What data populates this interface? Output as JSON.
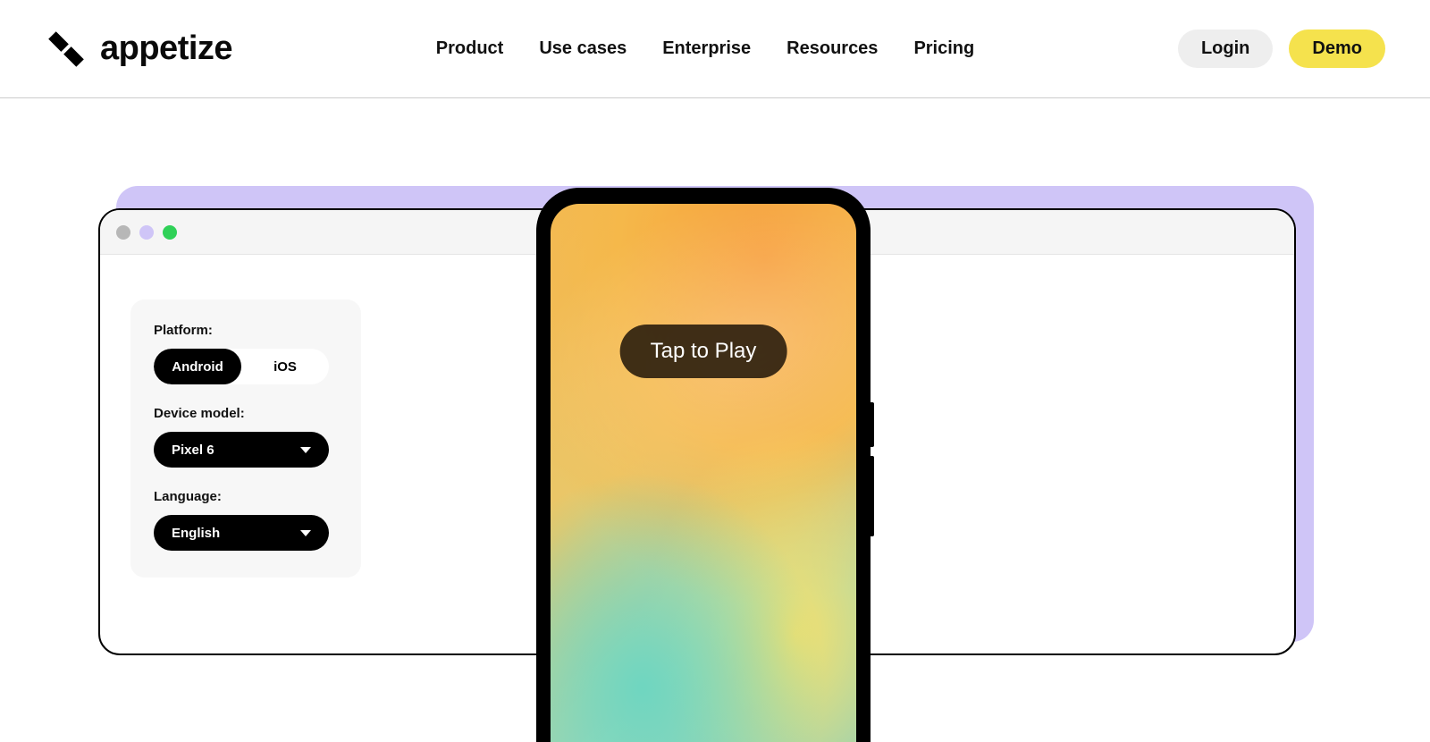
{
  "header": {
    "brand": "appetize",
    "nav": {
      "product": "Product",
      "useCases": "Use cases",
      "enterprise": "Enterprise",
      "resources": "Resources",
      "pricing": "Pricing"
    },
    "login": "Login",
    "demo": "Demo"
  },
  "controls": {
    "platformLabel": "Platform:",
    "platformOptions": {
      "android": "Android",
      "ios": "iOS"
    },
    "deviceModelLabel": "Device model:",
    "deviceModel": "Pixel 6",
    "languageLabel": "Language:",
    "language": "English"
  },
  "phone": {
    "tapToPlay": "Tap to Play"
  }
}
